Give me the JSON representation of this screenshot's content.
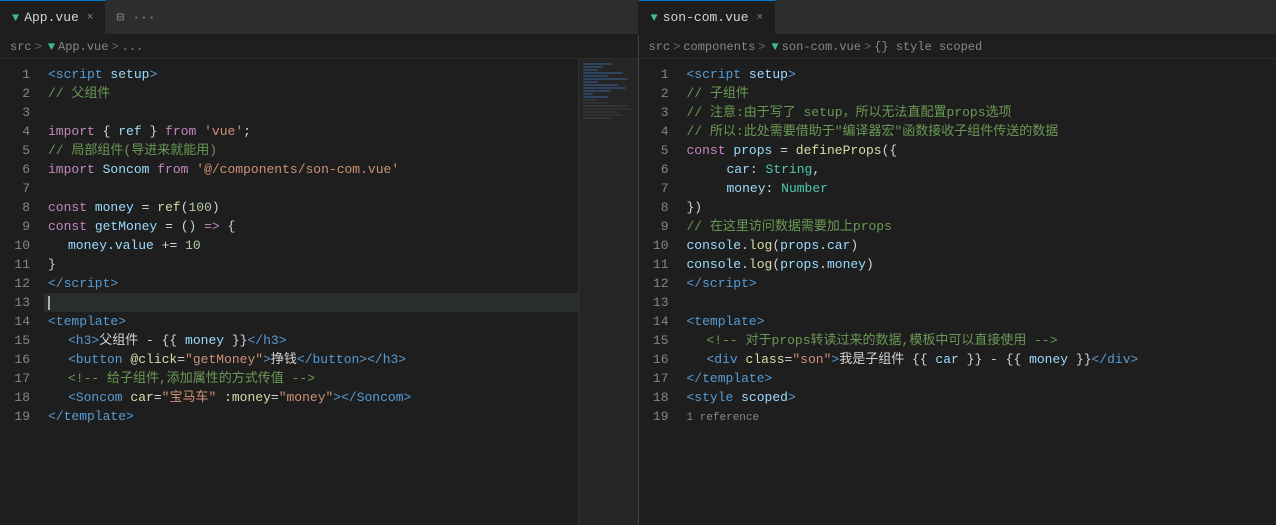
{
  "leftTab": {
    "icon": "▼",
    "label": "App.vue",
    "close": "×"
  },
  "rightTab": {
    "icon": "▼",
    "label": "son-com.vue",
    "close": "×"
  },
  "tabActions": {
    "split": "⊟",
    "more": "···"
  },
  "leftBreadcrumb": {
    "src": "src",
    "sep1": ">",
    "icon": "▼",
    "file": "App.vue",
    "sep2": ">",
    "ellipsis": "..."
  },
  "rightBreadcrumb": {
    "src": "src",
    "sep1": ">",
    "components": "components",
    "sep2": ">",
    "icon": "▼",
    "file": "son-com.vue",
    "sep3": ">",
    "scope": "{} style scoped"
  },
  "leftCode": [
    {
      "n": 1,
      "html": "<span class='kw'>&lt;script</span> <span class='attr'>setup</span><span class='kw'>&gt;</span>"
    },
    {
      "n": 2,
      "html": "<span class='comment'>// 父组件</span>"
    },
    {
      "n": 3,
      "html": ""
    },
    {
      "n": 4,
      "html": "<span class='kw2'>import</span> <span class='op'>{</span> <span class='blue'>ref</span> <span class='op'>}</span> <span class='kw2'>from</span> <span class='str'>'vue'</span><span class='op'>;</span>"
    },
    {
      "n": 5,
      "html": "<span class='comment'>// 局部组件(导进来就能用)</span>"
    },
    {
      "n": 6,
      "html": "<span class='kw2'>import</span> <span class='blue'>Soncom</span> <span class='kw2'>from</span> <span class='str'>'@/components/son-com.vue'</span>"
    },
    {
      "n": 7,
      "html": ""
    },
    {
      "n": 8,
      "html": "<span class='kw2'>const</span> <span class='blue'>money</span> <span class='op'>=</span> <span class='fn'>ref</span><span class='op'>(</span><span class='num'>100</span><span class='op'>)</span>"
    },
    {
      "n": 9,
      "html": "<span class='kw2'>const</span> <span class='blue'>getMoney</span> <span class='op'>=</span> <span class='op'>()</span> <span class='kw2'>=&gt;</span> <span class='op'>{</span>"
    },
    {
      "n": 10,
      "html": "<span class='indent1'><span class='blue'>money</span><span class='op'>.</span><span class='blue'>value</span> <span class='op'>+=</span> <span class='num'>10</span></span>"
    },
    {
      "n": 11,
      "html": "<span class='op'>}</span>"
    },
    {
      "n": 12,
      "html": "<span class='kw'>&lt;/script&gt;</span>"
    },
    {
      "n": 13,
      "html": "",
      "cursor": true
    },
    {
      "n": 14,
      "html": "<span class='kw'>&lt;template&gt;</span>"
    },
    {
      "n": 15,
      "html": "<span class='indent1'><span class='kw'>&lt;h3&gt;</span>父组件 - <span class='op'>{{</span> <span class='blue'>money</span> <span class='op'>}}</span><span class='kw'>&lt;/h3&gt;</span></span>"
    },
    {
      "n": 16,
      "html": "<span class='indent1'><span class='kw'>&lt;button</span> <span class='yellow'>@click</span><span class='op'>=</span><span class='str'>\"getMoney\"</span><span class='kw'>&gt;</span>挣钱<span class='kw'>&lt;/button&gt;&lt;/h3&gt;</span></span>"
    },
    {
      "n": 17,
      "html": "<span class='indent1'><span class='comment'>&lt;!-- 给子组件,添加属性的方式传值 --&gt;</span></span>"
    },
    {
      "n": 18,
      "html": "<span class='indent1'><span class='kw'>&lt;Soncom</span> <span class='yellow'>car</span><span class='op'>=</span><span class='str'>\"宝马车\"</span> <span class='yellow'>:money</span><span class='op'>=</span><span class='str'>\"money\"</span><span class='kw'>&gt;&lt;/Soncom&gt;</span></span>"
    },
    {
      "n": 19,
      "html": "<span class='kw'>&lt;/template&gt;</span>"
    }
  ],
  "rightCode": [
    {
      "n": 1,
      "html": "<span class='kw'>&lt;script</span> <span class='attr'>setup</span><span class='kw'>&gt;</span>"
    },
    {
      "n": 2,
      "html": "<span class='comment'>// 子组件</span>"
    },
    {
      "n": 3,
      "html": "<span class='comment'>// 注意:由于写了 setup，所以无法直配置props选项</span>"
    },
    {
      "n": 4,
      "html": "<span class='comment'>// 所以:此处需要借助于\"编译器宏\"函数接收子组件传送的数据</span>"
    },
    {
      "n": 5,
      "html": "<span class='kw2'>const</span> <span class='blue'>props</span> <span class='op'>=</span> <span class='fn'>defineProps</span><span class='op'>({</span>"
    },
    {
      "n": 6,
      "html": "<span class='indent2'><span class='blue'>car</span><span class='op'>:</span> <span class='tag'>String</span><span class='op'>,</span></span>"
    },
    {
      "n": 7,
      "html": "<span class='indent2'><span class='blue'>money</span><span class='op'>:</span> <span class='tag'>Number</span></span>"
    },
    {
      "n": 8,
      "html": "<span class='op'>})</span>"
    },
    {
      "n": 9,
      "html": "<span class='comment'>// 在这里访问数据需要加上props</span>"
    },
    {
      "n": 10,
      "html": "<span class='blue'>console</span><span class='op'>.</span><span class='fn'>log</span><span class='op'>(</span><span class='blue'>props</span><span class='op'>.</span><span class='blue'>car</span><span class='op'>)</span>"
    },
    {
      "n": 11,
      "html": "<span class='blue'>console</span><span class='op'>.</span><span class='fn'>log</span><span class='op'>(</span><span class='blue'>props</span><span class='op'>.</span><span class='blue'>money</span><span class='op'>)</span>"
    },
    {
      "n": 12,
      "html": "<span class='kw'>&lt;/script&gt;</span>"
    },
    {
      "n": 13,
      "html": ""
    },
    {
      "n": 14,
      "html": "<span class='kw'>&lt;template&gt;</span>"
    },
    {
      "n": 15,
      "html": "<span class='indent1'><span class='comment'>&lt;!-- 对于props转读过来的数据,模板中可以直接使用 --&gt;</span></span>"
    },
    {
      "n": 16,
      "html": "<span class='indent1'><span class='kw'>&lt;div</span> <span class='yellow'>class</span><span class='op'>=</span><span class='str'>\"son\"</span><span class='kw'>&gt;</span>我是子组件 <span class='op'>{{</span> <span class='blue'>car</span> <span class='op'>}}</span> - <span class='op'>{{</span> <span class='blue'>money</span> <span class='op'>}}</span><span class='kw'>&lt;/div&gt;</span></span>"
    },
    {
      "n": 17,
      "html": "<span class='kw'>&lt;/template&gt;</span>"
    },
    {
      "n": 18,
      "html": "<span class='kw'>&lt;style</span> <span class='blue'>scoped</span><span class='kw'>&gt;</span>"
    },
    {
      "n": 19,
      "html": "<span class='ref-note'>1 reference</span>"
    }
  ]
}
